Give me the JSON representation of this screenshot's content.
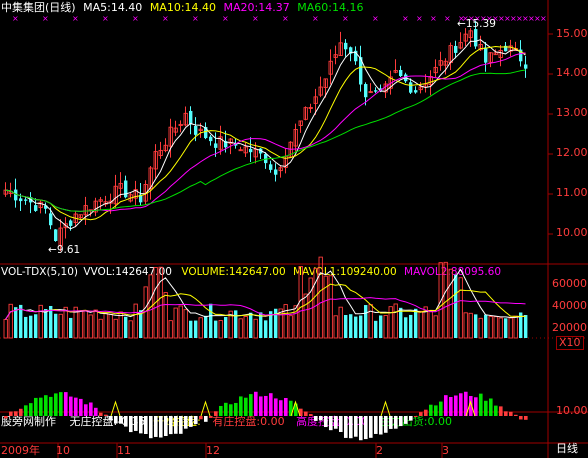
{
  "colors": {
    "background": "#000000",
    "frame": "#a00000",
    "up": "#ff3c3c",
    "down": "#54fcfc",
    "ma5": "#ffffff",
    "ma10": "#ffff00",
    "ma20": "#ff00ff",
    "ma60": "#00e000",
    "axis_text": "#ff3c3c"
  },
  "price_header": {
    "title": "中集集团(日线)",
    "ma5": "MA5:14.40",
    "ma10": "MA10:14.40",
    "ma20": "MA20:14.37",
    "ma60": "MA60:14.16"
  },
  "vol_header": {
    "name": "VOL-TDX(5,10)",
    "vvol": "VVOL:142647.00",
    "volume": "VOLUME:142647.00",
    "mavol1": "MAVOL1:109240.00",
    "mavol2": "MAVOL2:88095.60"
  },
  "ind_header": {
    "maker": "股旁网制作",
    "item1": "无庄控盘:-0.35",
    "item2": "开始控盘:",
    "item3": "有庄控盘:0.00",
    "item4": "高度控盘:0.00",
    "item5": "主力出货:0.00"
  },
  "price_axis": [
    "15.00",
    "14.00",
    "13.00",
    "12.00",
    "11.00",
    "10.00"
  ],
  "vol_axis": [
    "60000",
    "40000",
    "20000"
  ],
  "vol_unit": "X10",
  "ind_axis": [
    "10.00"
  ],
  "date_axis": [
    "2009年",
    "10",
    "11",
    "12",
    "2",
    "3"
  ],
  "period_label": "日线",
  "annotations": {
    "high": "15.39",
    "low": "9.61"
  },
  "chart_data": {
    "type": "candlestick",
    "title": "中集集团(日线)",
    "x": [
      "2009年",
      "10",
      "11",
      "12",
      "2",
      "3"
    ],
    "high": 15.39,
    "low": 9.61,
    "price_range": [
      9.4,
      15.4
    ],
    "ma_last": {
      "MA5": 14.4,
      "MA10": 14.4,
      "MA20": 14.37,
      "MA60": 14.16
    },
    "volume_last": 142647.0,
    "mavol1_last": 109240.0,
    "mavol2_last": 88095.6,
    "volume_range": [
      0,
      70000
    ]
  }
}
